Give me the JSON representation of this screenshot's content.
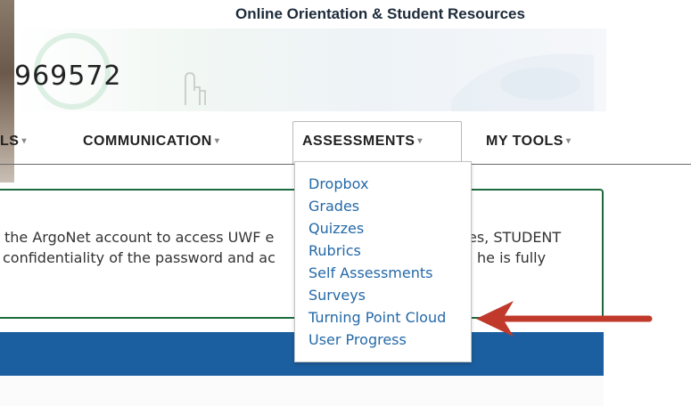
{
  "site": {
    "title": "Online Orientation & Student Resources"
  },
  "banner": {
    "number": "969572"
  },
  "nav": {
    "items": [
      {
        "label": "LS",
        "caret": "▾"
      },
      {
        "label": "COMMUNICATION",
        "caret": "▾"
      },
      {
        "label": "ASSESSMENTS",
        "caret": "▾"
      },
      {
        "label": "MY TOOLS",
        "caret": "▾"
      }
    ]
  },
  "assessments_menu": {
    "items": [
      {
        "label": "Dropbox"
      },
      {
        "label": "Grades"
      },
      {
        "label": "Quizzes"
      },
      {
        "label": "Rubrics"
      },
      {
        "label": "Self Assessments"
      },
      {
        "label": "Surveys"
      },
      {
        "label": "Turning Point Cloud"
      },
      {
        "label": "User Progress"
      }
    ]
  },
  "notice": {
    "line1_left": "the ArgoNet account to access UWF e",
    "line1_right": "es, STUDENT",
    "line2_left": "confidentiality of the password and ac",
    "line2_right": "he is fully"
  },
  "colors": {
    "annotation_arrow": "#c0392b",
    "link": "#2469a8",
    "blue_bar": "#1b5fa0",
    "notice_border": "#1c6a3d"
  }
}
